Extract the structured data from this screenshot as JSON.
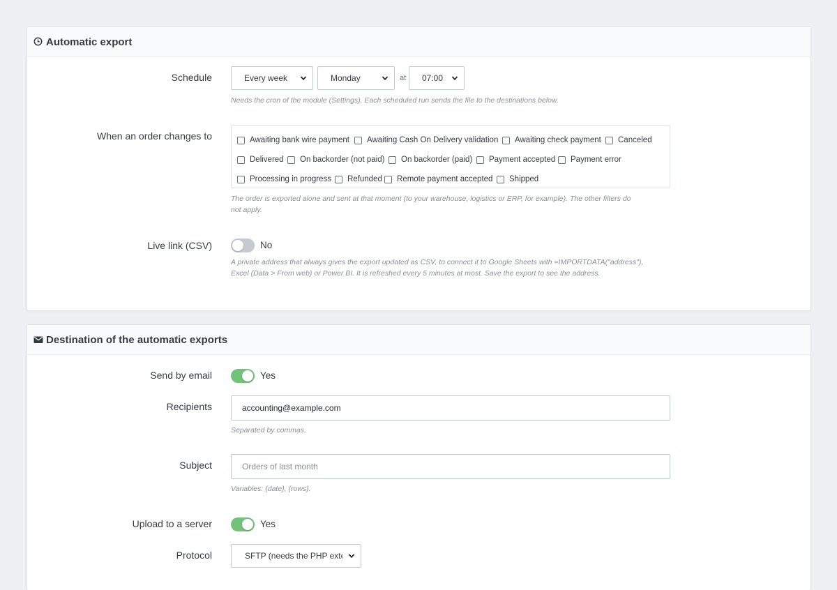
{
  "auto_export": {
    "title": "Automatic export",
    "schedule": {
      "label": "Schedule",
      "frequency": "Every week",
      "day": "Monday",
      "at": "at",
      "time": "07:00",
      "help": "Needs the cron of the module (Settings). Each scheduled run sends the file to the destinations below."
    },
    "order_change": {
      "label": "When an order changes to",
      "statuses": [
        "Awaiting bank wire payment",
        "Awaiting Cash On Delivery validation",
        "Awaiting check payment",
        "Canceled",
        "Delivered",
        "On backorder (not paid)",
        "On backorder (paid)",
        "Payment accepted",
        "Payment error",
        "Processing in progress",
        "Refunded",
        "Remote payment accepted",
        "Shipped"
      ],
      "help_line1": "The order is exported alone and sent at that moment (to your warehouse, logistics or ERP, for example). The other filters do",
      "help_line2": "not apply."
    },
    "live_link": {
      "label": "Live link (CSV)",
      "state": "No",
      "help_line1": "A private address that always gives the export updated as CSV, to connect it to Google Sheets with =IMPORTDATA(\"address\"),",
      "help_line2": "Excel (Data > From web) or Power BI. It is refreshed every 5 minutes at most. Save the export to see the address."
    }
  },
  "destination": {
    "title": "Destination of the automatic exports",
    "send_email": {
      "label": "Send by email",
      "state": "Yes"
    },
    "recipients": {
      "label": "Recipients",
      "value": "accounting@example.com",
      "help": "Separated by commas."
    },
    "subject": {
      "label": "Subject",
      "placeholder": "Orders of last month",
      "help": "Variables: {date}, {rows}."
    },
    "upload": {
      "label": "Upload to a server",
      "state": "Yes"
    },
    "protocol": {
      "label": "Protocol",
      "value": "SFTP (needs the PHP exter"
    }
  },
  "colors": {
    "switch_on": "#72c279",
    "switch_off": "#c5cad0",
    "background": "#eef0f3"
  }
}
